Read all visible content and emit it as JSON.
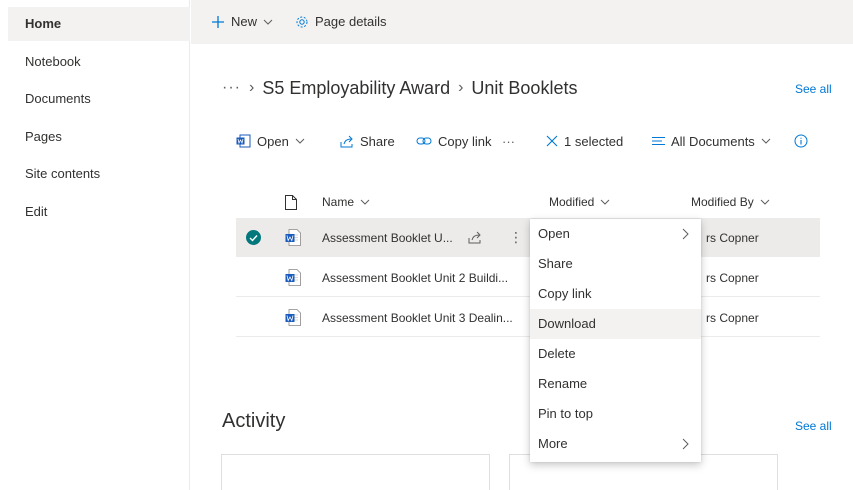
{
  "nav": {
    "items": [
      {
        "label": "Home",
        "active": true
      },
      {
        "label": "Notebook"
      },
      {
        "label": "Documents"
      },
      {
        "label": "Pages"
      },
      {
        "label": "Site contents"
      },
      {
        "label": "Edit"
      }
    ]
  },
  "command_bar": {
    "new_label": "New",
    "page_details_label": "Page details"
  },
  "breadcrumb": {
    "overflow": "···",
    "items": [
      "S5 Employability Award",
      "Unit Booklets"
    ],
    "see_all": "See all"
  },
  "library_toolbar": {
    "open_label": "Open",
    "share_label": "Share",
    "copy_link_label": "Copy link",
    "more": "···",
    "selected_label": "1 selected",
    "view_label": "All Documents"
  },
  "list": {
    "columns": {
      "name": "Name",
      "modified": "Modified",
      "modified_by": "Modified By"
    },
    "rows": [
      {
        "name": "Assessment Booklet U...",
        "modified_by": "rs Copner",
        "selected": true
      },
      {
        "name": "Assessment Booklet Unit 2 Buildi...",
        "modified_by": "rs Copner"
      },
      {
        "name": "Assessment Booklet Unit 3 Dealin...",
        "modified_by": "rs Copner"
      }
    ]
  },
  "context_menu": {
    "items": [
      {
        "label": "Open",
        "submenu": true
      },
      {
        "label": "Share"
      },
      {
        "label": "Copy link"
      },
      {
        "label": "Download",
        "hover": true
      },
      {
        "label": "Delete"
      },
      {
        "label": "Rename"
      },
      {
        "label": "Pin to top"
      },
      {
        "label": "More",
        "submenu": true
      }
    ]
  },
  "activity": {
    "title": "Activity",
    "see_all": "See all"
  },
  "colors": {
    "accent": "#0078d4",
    "check": "#03787c",
    "word": "#185abd",
    "command_bg": "#f3f2f1"
  },
  "icons": {
    "new": "plus-icon",
    "page_details": "gear-icon",
    "open": "word-app-icon",
    "share": "share-icon",
    "copy_link": "link-icon",
    "clear_selection": "close-icon",
    "view": "lines-icon",
    "info": "info-icon",
    "file_type": "document-icon",
    "word_file": "word-file-icon",
    "selected": "check-circle-icon"
  }
}
